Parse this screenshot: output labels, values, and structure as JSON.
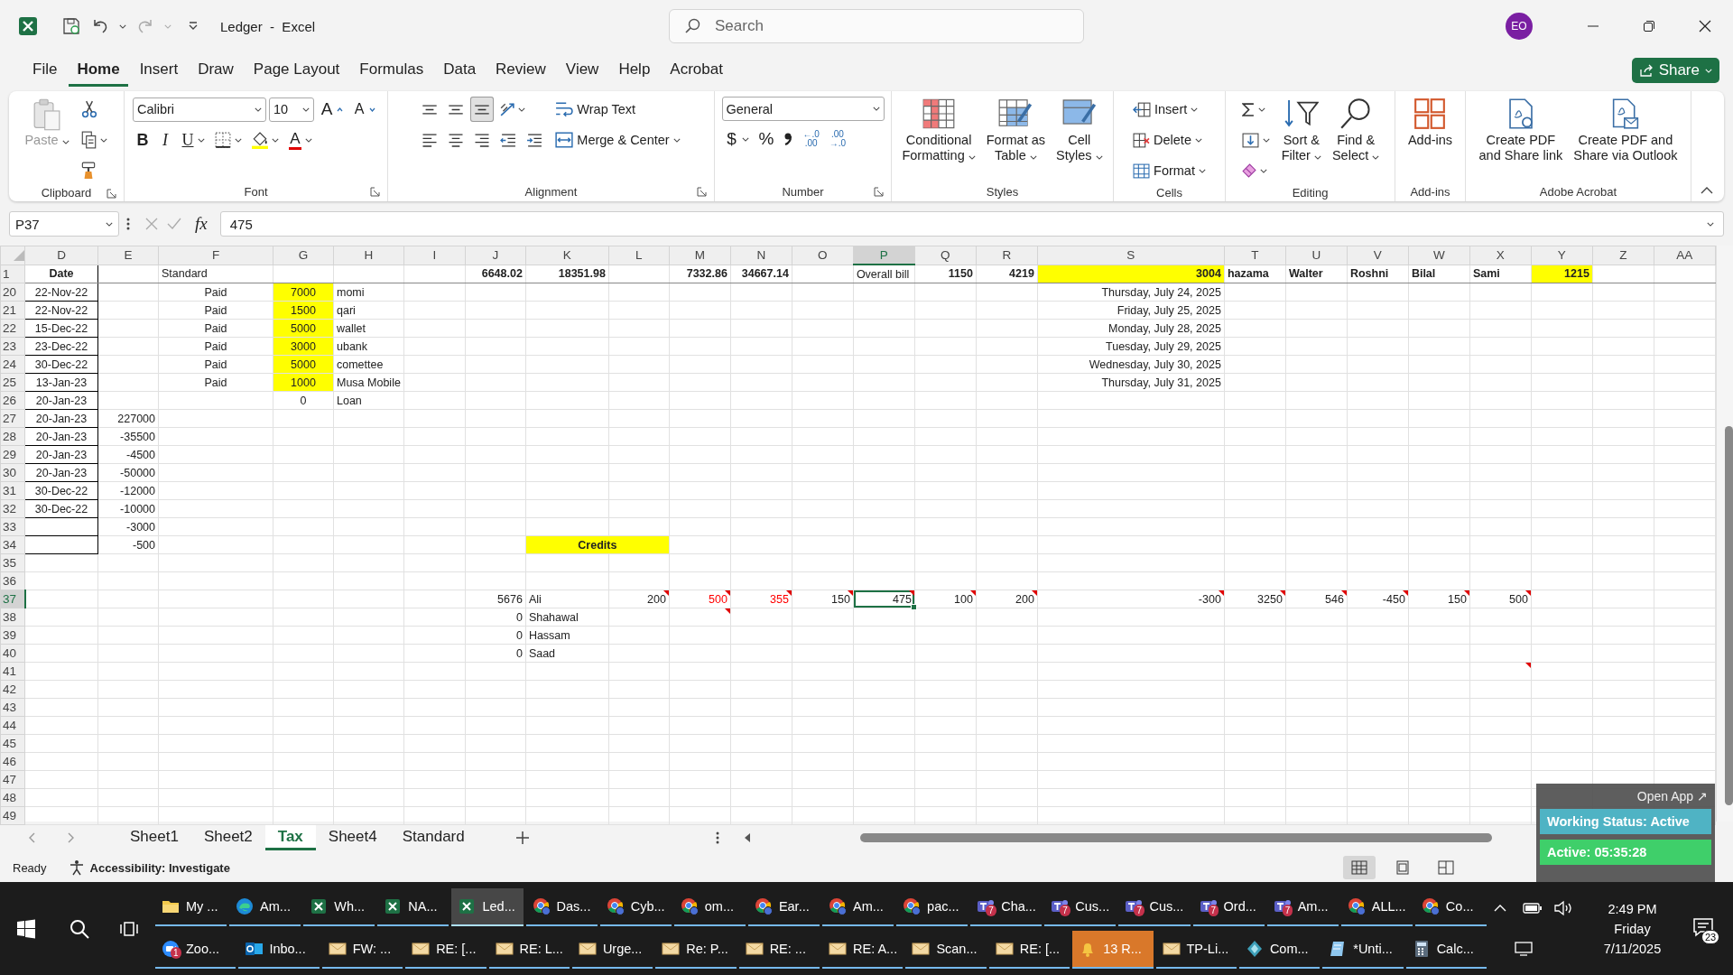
{
  "title_bar": {
    "title": "Ledger  -  Excel",
    "search": {
      "placeholder": "Search"
    },
    "account": {
      "initials": "EO"
    }
  },
  "menu": {
    "tabs": [
      {
        "label": "File",
        "selected": false
      },
      {
        "label": "Home",
        "selected": true
      },
      {
        "label": "Insert",
        "selected": false
      },
      {
        "label": "Draw",
        "selected": false
      },
      {
        "label": "Page Layout",
        "selected": false
      },
      {
        "label": "Formulas",
        "selected": false
      },
      {
        "label": "Data",
        "selected": false
      },
      {
        "label": "Review",
        "selected": false
      },
      {
        "label": "View",
        "selected": false
      },
      {
        "label": "Help",
        "selected": false
      },
      {
        "label": "Acrobat",
        "selected": false
      }
    ],
    "share": "Share"
  },
  "ribbon": {
    "groups": [
      {
        "label": "Clipboard",
        "launcher": true,
        "sections": [
          {
            "kind": "paste",
            "lines": [
              "Paste"
            ],
            "dropdown": true,
            "disabled": true
          },
          {
            "kind": "rows",
            "rows": [
              {
                "tools": [
                  {
                    "kind": "cut"
                  }
                ]
              },
              {
                "tools": [
                  {
                    "kind": "copy",
                    "dropdown": true
                  }
                ]
              },
              {
                "tools": [
                  {
                    "kind": "format-painter"
                  }
                ]
              }
            ]
          }
        ]
      },
      {
        "label": "Font",
        "launcher": true,
        "sections": [
          {
            "kind": "rows",
            "rows": [
              {
                "tools": [
                  {
                    "kind": "font-name",
                    "value": "Calibri"
                  },
                  {
                    "kind": "font-size",
                    "value": "10"
                  },
                  {
                    "kind": "grow-font",
                    "text": "A"
                  },
                  {
                    "kind": "shrink-font",
                    "text": "A"
                  }
                ]
              },
              {
                "tools": [
                  {
                    "kind": "bold",
                    "text": "B"
                  },
                  {
                    "kind": "italic",
                    "text": "I"
                  },
                  {
                    "kind": "underline",
                    "text": "U",
                    "dropdown": true
                  },
                  {
                    "kind": "borders",
                    "dropdown": true
                  },
                  {
                    "kind": "fill-color",
                    "dropdown": true
                  },
                  {
                    "kind": "font-color",
                    "text": "A",
                    "dropdown": true
                  }
                ]
              }
            ]
          }
        ]
      },
      {
        "label": "Alignment",
        "launcher": true,
        "sections": [
          {
            "kind": "rows",
            "rows": [
              {
                "tools": [
                  {
                    "kind": "align-top",
                    "selected": false
                  },
                  {
                    "kind": "align-middle",
                    "selected": false
                  },
                  {
                    "kind": "align-bottom",
                    "selected": true
                  },
                  {
                    "kind": "orientation",
                    "dropdown": true,
                    "selected": false
                  }
                ]
              },
              {
                "tools": [
                  {
                    "kind": "align-left",
                    "selected": false
                  },
                  {
                    "kind": "align-center",
                    "selected": false
                  },
                  {
                    "kind": "align-right",
                    "selected": false
                  },
                  {
                    "kind": "outdent",
                    "selected": false
                  },
                  {
                    "kind": "indent",
                    "selected": false
                  }
                ]
              }
            ]
          },
          {
            "kind": "rows",
            "rows": [
              {
                "tools": [
                  {
                    "kind": "wrap-text",
                    "label": "Wrap Text"
                  }
                ]
              },
              {
                "tools": [
                  {
                    "kind": "merge",
                    "label": "Merge & Center",
                    "dropdown": true
                  }
                ]
              }
            ]
          }
        ]
      },
      {
        "label": "Number",
        "launcher": true,
        "sections": [
          {
            "kind": "rows",
            "rows": [
              {
                "tools": [
                  {
                    "kind": "number-format",
                    "value": "General"
                  }
                ]
              },
              {
                "tools": [
                  {
                    "kind": "currency",
                    "text": "$",
                    "dropdown": true
                  },
                  {
                    "kind": "percent",
                    "text": "%"
                  },
                  {
                    "kind": "comma"
                  },
                  {
                    "kind": "add-decimal",
                    "lines": [
                      "←.0",
                      ".00"
                    ]
                  },
                  {
                    "kind": "remove-decimal",
                    "lines": [
                      ".00",
                      "→.0"
                    ]
                  }
                ]
              }
            ]
          }
        ]
      },
      {
        "label": "Styles",
        "sections": [
          {
            "kind": "conditional-formatting",
            "lines": [
              "Conditional",
              "Formatting"
            ],
            "dropdown": true
          },
          {
            "kind": "format-as-table",
            "lines": [
              "Format as",
              "Table"
            ],
            "dropdown": true
          },
          {
            "kind": "cell-styles",
            "lines": [
              "Cell",
              "Styles"
            ],
            "dropdown": true
          }
        ]
      },
      {
        "label": "Cells",
        "sections": [
          {
            "kind": "rows",
            "rows": [
              {
                "tools": [
                  {
                    "kind": "insert-cells",
                    "label": "Insert",
                    "dropdown": true
                  }
                ]
              },
              {
                "tools": [
                  {
                    "kind": "delete-cells",
                    "label": "Delete",
                    "dropdown": true
                  }
                ]
              },
              {
                "tools": [
                  {
                    "kind": "format-cells",
                    "label": "Format",
                    "dropdown": true
                  }
                ]
              }
            ]
          }
        ]
      },
      {
        "label": "Editing",
        "sections": [
          {
            "kind": "rows",
            "rows": [
              {
                "tools": [
                  {
                    "kind": "autosum",
                    "dropdown": true
                  }
                ]
              },
              {
                "tools": [
                  {
                    "kind": "fill-down",
                    "dropdown": true
                  }
                ]
              },
              {
                "tools": [
                  {
                    "kind": "clear",
                    "dropdown": true
                  }
                ]
              }
            ]
          },
          {
            "kind": "sort-filter",
            "lines": [
              "Sort &",
              "Filter"
            ],
            "dropdown": true
          },
          {
            "kind": "find-select",
            "lines": [
              "Find &",
              "Select"
            ],
            "dropdown": true
          }
        ]
      },
      {
        "label": "Add-ins",
        "sections": [
          {
            "kind": "add-ins",
            "lines": [
              "Add-ins"
            ]
          }
        ]
      },
      {
        "label": "Adobe Acrobat",
        "sections": [
          {
            "kind": "pdf-link",
            "lines": [
              "Create PDF",
              "and Share link"
            ]
          },
          {
            "kind": "pdf-mail",
            "lines": [
              "Create PDF and",
              "Share via Outlook"
            ]
          }
        ]
      }
    ]
  },
  "formula_bar": {
    "name_box": "P37",
    "fx": "fx",
    "value": "475"
  },
  "sheet": {
    "columns": [
      {
        "label": "D",
        "selected": false
      },
      {
        "label": "E",
        "selected": false
      },
      {
        "label": "F",
        "selected": false
      },
      {
        "label": "G",
        "selected": false
      },
      {
        "label": "H",
        "selected": false
      },
      {
        "label": "I",
        "selected": false
      },
      {
        "label": "J",
        "selected": false
      },
      {
        "label": "K",
        "selected": false
      },
      {
        "label": "L",
        "selected": false
      },
      {
        "label": "M",
        "selected": false
      },
      {
        "label": "N",
        "selected": false
      },
      {
        "label": "O",
        "selected": false
      },
      {
        "label": "P",
        "selected": true
      },
      {
        "label": "Q",
        "selected": false
      },
      {
        "label": "R",
        "selected": false
      },
      {
        "label": "S",
        "selected": false
      },
      {
        "label": "T",
        "selected": false
      },
      {
        "label": "U",
        "selected": false
      },
      {
        "label": "V",
        "selected": false
      },
      {
        "label": "W",
        "selected": false
      },
      {
        "label": "X",
        "selected": false
      },
      {
        "label": "Y",
        "selected": false
      },
      {
        "label": "Z",
        "selected": false
      },
      {
        "label": "AA",
        "selected": false
      }
    ],
    "rows": [
      {
        "number": "1",
        "selected": false,
        "cells": {
          "D": {
            "text": "Date",
            "kind": "center",
            "bold": true,
            "boxed": true,
            "selected": false
          },
          "F": {
            "text": "Standard",
            "kind": "text",
            "selected": false
          },
          "J": {
            "text": "6648.02",
            "kind": "number",
            "bold": true,
            "selected": false
          },
          "K": {
            "text": "18351.98",
            "kind": "number",
            "bold": true,
            "selected": false
          },
          "M": {
            "text": "7332.86",
            "kind": "number",
            "bold": true,
            "selected": false
          },
          "N": {
            "text": "34667.14",
            "kind": "number",
            "bold": true,
            "selected": false
          },
          "P": {
            "text": "Overall bill",
            "kind": "text",
            "selected": false
          },
          "Q": {
            "text": "1150",
            "kind": "number",
            "bold": true,
            "selected": false
          },
          "R": {
            "text": "4219",
            "kind": "number",
            "bold": true,
            "selected": false
          },
          "S": {
            "text": "3004",
            "kind": "number",
            "bold": true,
            "highlighted": true,
            "selected": false
          },
          "T": {
            "text": "hazama",
            "kind": "text",
            "bold": true,
            "selected": false
          },
          "U": {
            "text": "Walter",
            "kind": "text",
            "bold": true,
            "selected": false
          },
          "V": {
            "text": "Roshni",
            "kind": "text",
            "bold": true,
            "selected": false
          },
          "W": {
            "text": "Bilal",
            "kind": "text",
            "bold": true,
            "selected": false
          },
          "X": {
            "text": "Sami",
            "kind": "text",
            "bold": true,
            "selected": false
          },
          "Y": {
            "text": "1215",
            "kind": "number",
            "bold": true,
            "highlighted": true,
            "selected": false
          }
        }
      },
      {
        "number": "20",
        "selected": false,
        "cells": {
          "D": {
            "text": "22-Nov-22",
            "kind": "center",
            "boxed": true,
            "selected": false
          },
          "F": {
            "text": "Paid",
            "kind": "center",
            "selected": false
          },
          "G": {
            "text": "7000",
            "kind": "center",
            "highlighted": true,
            "selected": false
          },
          "H": {
            "text": "momi",
            "selected": false
          },
          "S": {
            "text": "Thursday, July 24, 2025",
            "kind": "number",
            "selected": false
          }
        }
      },
      {
        "number": "21",
        "selected": false,
        "cells": {
          "D": {
            "text": "22-Nov-22",
            "kind": "center",
            "boxed": true,
            "selected": false
          },
          "F": {
            "text": "Paid",
            "kind": "center",
            "selected": false
          },
          "G": {
            "text": "1500",
            "kind": "center",
            "highlighted": true,
            "selected": false
          },
          "H": {
            "text": "qari",
            "selected": false
          },
          "S": {
            "text": "Friday, July 25, 2025",
            "kind": "number",
            "selected": false
          }
        }
      },
      {
        "number": "22",
        "selected": false,
        "cells": {
          "D": {
            "text": "15-Dec-22",
            "kind": "center",
            "boxed": true,
            "selected": false
          },
          "F": {
            "text": "Paid",
            "kind": "center",
            "selected": false
          },
          "G": {
            "text": "5000",
            "kind": "center",
            "highlighted": true,
            "selected": false
          },
          "H": {
            "text": "wallet",
            "selected": false
          },
          "S": {
            "text": "Monday, July 28, 2025",
            "kind": "number",
            "selected": false
          }
        }
      },
      {
        "number": "23",
        "selected": false,
        "cells": {
          "D": {
            "text": "23-Dec-22",
            "kind": "center",
            "boxed": true,
            "selected": false
          },
          "F": {
            "text": "Paid",
            "kind": "center",
            "selected": false
          },
          "G": {
            "text": "3000",
            "kind": "center",
            "highlighted": true,
            "selected": false
          },
          "H": {
            "text": "ubank",
            "selected": false
          },
          "S": {
            "text": "Tuesday, July 29, 2025",
            "kind": "number",
            "selected": false
          }
        }
      },
      {
        "number": "24",
        "selected": false,
        "cells": {
          "D": {
            "text": "30-Dec-22",
            "kind": "center",
            "boxed": true,
            "selected": false
          },
          "F": {
            "text": "Paid",
            "kind": "center",
            "selected": false
          },
          "G": {
            "text": "5000",
            "kind": "center",
            "highlighted": true,
            "selected": false
          },
          "H": {
            "text": "comettee",
            "selected": false
          },
          "S": {
            "text": "Wednesday, July 30, 2025",
            "kind": "number",
            "selected": false
          }
        }
      },
      {
        "number": "25",
        "selected": false,
        "cells": {
          "D": {
            "text": "13-Jan-23",
            "kind": "center",
            "boxed": true,
            "selected": false
          },
          "F": {
            "text": "Paid",
            "kind": "center",
            "selected": false
          },
          "G": {
            "text": "1000",
            "kind": "center",
            "highlighted": true,
            "selected": false
          },
          "H": {
            "text": "Musa Mobile",
            "selected": false
          },
          "S": {
            "text": "Thursday, July 31, 2025",
            "kind": "number",
            "selected": false
          }
        }
      },
      {
        "number": "26",
        "selected": false,
        "cells": {
          "D": {
            "text": "20-Jan-23",
            "kind": "center",
            "boxed": true,
            "selected": false
          },
          "G": {
            "text": "0",
            "kind": "center",
            "selected": false
          },
          "H": {
            "text": "Loan",
            "selected": false
          }
        }
      },
      {
        "number": "27",
        "selected": false,
        "cells": {
          "D": {
            "text": "20-Jan-23",
            "kind": "center",
            "boxed": true,
            "selected": false
          },
          "E": {
            "text": "227000",
            "kind": "number",
            "selected": false
          }
        }
      },
      {
        "number": "28",
        "selected": false,
        "cells": {
          "D": {
            "text": "20-Jan-23",
            "kind": "center",
            "boxed": true,
            "selected": false
          },
          "E": {
            "text": "-35500",
            "kind": "number",
            "selected": false
          }
        }
      },
      {
        "number": "29",
        "selected": false,
        "cells": {
          "D": {
            "text": "20-Jan-23",
            "kind": "center",
            "boxed": true,
            "selected": false
          },
          "E": {
            "text": "-4500",
            "kind": "number",
            "selected": false
          }
        }
      },
      {
        "number": "30",
        "selected": false,
        "cells": {
          "D": {
            "text": "20-Jan-23",
            "kind": "center",
            "boxed": true,
            "selected": false
          },
          "E": {
            "text": "-50000",
            "kind": "number",
            "selected": false
          }
        }
      },
      {
        "number": "31",
        "selected": false,
        "cells": {
          "D": {
            "text": "30-Dec-22",
            "kind": "center",
            "boxed": true,
            "selected": false
          },
          "E": {
            "text": "-12000",
            "kind": "number",
            "selected": false
          }
        }
      },
      {
        "number": "32",
        "selected": false,
        "cells": {
          "D": {
            "text": "30-Dec-22",
            "kind": "center",
            "boxed": true,
            "selected": false
          },
          "E": {
            "text": "-10000",
            "kind": "number",
            "selected": false
          }
        }
      },
      {
        "number": "33",
        "selected": false,
        "cells": {
          "D": {
            "boxed": true,
            "selected": false
          },
          "E": {
            "text": "-3000",
            "kind": "number",
            "selected": false
          }
        }
      },
      {
        "number": "34",
        "selected": false,
        "cells": {
          "D": {
            "boxed": true,
            "selected": false
          },
          "E": {
            "text": "-500",
            "kind": "number",
            "selected": false
          },
          "K": {
            "text": "Credits",
            "kind": "center",
            "bold": true,
            "highlighted": true,
            "merged": true,
            "selected": false
          }
        }
      },
      {
        "number": "35",
        "selected": false
      },
      {
        "number": "36",
        "selected": false
      },
      {
        "number": "37",
        "selected": true,
        "cells": {
          "J": {
            "text": "5676",
            "kind": "number",
            "selected": false
          },
          "K": {
            "text": "Ali",
            "kind": "text",
            "selected": false
          },
          "L": {
            "text": "200",
            "kind": "number",
            "comment": true,
            "selected": false
          },
          "M": {
            "text": "500",
            "kind": "number",
            "comment": true,
            "color": "#ff0000",
            "selected": false
          },
          "N": {
            "text": "355",
            "kind": "number",
            "comment": true,
            "color": "#ff0000",
            "selected": false
          },
          "O": {
            "text": "150",
            "kind": "number",
            "comment": true,
            "selected": false
          },
          "P": {
            "text": "475",
            "kind": "number",
            "comment": true,
            "selected": true
          },
          "Q": {
            "text": "100",
            "kind": "number",
            "comment": true,
            "selected": false
          },
          "R": {
            "text": "200",
            "kind": "number",
            "comment": true,
            "selected": false
          },
          "S": {
            "text": "-300",
            "kind": "number",
            "comment": true,
            "selected": false
          },
          "T": {
            "text": "3250",
            "kind": "number",
            "comment": true,
            "selected": false
          },
          "U": {
            "text": "546",
            "kind": "number",
            "comment": true,
            "selected": false
          },
          "V": {
            "text": "-450",
            "kind": "number",
            "comment": true,
            "selected": false
          },
          "W": {
            "text": "150",
            "kind": "number",
            "comment": true,
            "selected": false
          },
          "X": {
            "text": "500",
            "kind": "number",
            "comment": true,
            "selected": false
          }
        }
      },
      {
        "number": "38",
        "selected": false,
        "cells": {
          "J": {
            "text": "0",
            "kind": "number",
            "selected": false
          },
          "K": {
            "text": "Shahawal",
            "kind": "text",
            "selected": false
          },
          "M": {
            "comment": true,
            "selected": false
          }
        }
      },
      {
        "number": "39",
        "selected": false,
        "cells": {
          "J": {
            "text": "0",
            "kind": "number",
            "selected": false
          },
          "K": {
            "text": "Hassam",
            "kind": "text",
            "selected": false
          }
        }
      },
      {
        "number": "40",
        "selected": false,
        "cells": {
          "J": {
            "text": "0",
            "kind": "number",
            "selected": false
          },
          "K": {
            "text": "Saad",
            "kind": "text",
            "selected": false
          }
        }
      },
      {
        "number": "41",
        "selected": false,
        "cells": {
          "X": {
            "comment": true,
            "selected": false
          }
        }
      },
      {
        "number": "42",
        "selected": false
      },
      {
        "number": "43",
        "selected": false
      },
      {
        "number": "44",
        "selected": false
      },
      {
        "number": "45",
        "selected": false
      },
      {
        "number": "46",
        "selected": false
      },
      {
        "number": "47",
        "selected": false
      },
      {
        "number": "48",
        "selected": false
      },
      {
        "number": "49",
        "selected": false
      }
    ]
  },
  "sheet_tabs": [
    {
      "label": "Sheet1",
      "selected": false
    },
    {
      "label": "Sheet2",
      "selected": false
    },
    {
      "label": "Tax",
      "selected": true
    },
    {
      "label": "Sheet4",
      "selected": false
    },
    {
      "label": "Standard",
      "selected": false
    }
  ],
  "status_bar": {
    "mode": "Ready",
    "accessibility": "Accessibility: Investigate",
    "views": [
      {
        "kind": "normal",
        "selected": true
      },
      {
        "kind": "page-layout",
        "selected": false
      },
      {
        "kind": "page-break",
        "selected": false
      }
    ]
  },
  "overlay": {
    "open_app": "Open App ↗",
    "status": "Working Status: Active",
    "timer": "Active: 05:35:28"
  },
  "taskbar": {
    "rows": [
      {
        "items": [
          {
            "label": "My ...",
            "kind": "folder",
            "selected": false
          },
          {
            "label": "Am...",
            "kind": "edge",
            "selected": false
          },
          {
            "label": "Wh...",
            "kind": "excel",
            "selected": false
          },
          {
            "label": "NA...",
            "kind": "excel",
            "selected": false
          },
          {
            "label": "Led...",
            "kind": "excel",
            "selected": true
          },
          {
            "label": "Das...",
            "kind": "chrome",
            "selected": false
          },
          {
            "label": "Cyb...",
            "kind": "chrome",
            "selected": false
          },
          {
            "label": "om...",
            "kind": "chrome",
            "selected": false
          },
          {
            "label": "Ear...",
            "kind": "chrome",
            "selected": false
          },
          {
            "label": "Am...",
            "kind": "chrome",
            "selected": false
          },
          {
            "label": "pac...",
            "kind": "chrome",
            "selected": false
          },
          {
            "label": "Cha...",
            "kind": "teams",
            "badge": "7",
            "selected": false
          },
          {
            "label": "Cus...",
            "kind": "teams",
            "badge": "7",
            "selected": false
          },
          {
            "label": "Cus...",
            "kind": "teams",
            "badge": "7",
            "selected": false
          },
          {
            "label": "Ord...",
            "kind": "teams",
            "badge": "7",
            "selected": false
          },
          {
            "label": "Am...",
            "kind": "teams",
            "badge": "7",
            "selected": false
          },
          {
            "label": "ALL...",
            "kind": "chrome",
            "selected": false
          },
          {
            "label": "Co...",
            "kind": "chrome",
            "selected": false
          }
        ]
      },
      {
        "items": [
          {
            "label": "Zoo...",
            "kind": "zoom",
            "badge": "1",
            "selected": false
          },
          {
            "label": "Inbo...",
            "kind": "outlook",
            "selected": false
          },
          {
            "label": "FW: ...",
            "kind": "mail",
            "selected": false
          },
          {
            "label": "RE: [...",
            "kind": "mail",
            "selected": false
          },
          {
            "label": "RE: L...",
            "kind": "mail",
            "selected": false
          },
          {
            "label": "Urge...",
            "kind": "mail",
            "selected": false
          },
          {
            "label": "Re: P...",
            "kind": "mail",
            "selected": false
          },
          {
            "label": "RE: ...",
            "kind": "mail",
            "selected": false
          },
          {
            "label": "RE: A...",
            "kind": "mail",
            "selected": false
          },
          {
            "label": "Scan...",
            "kind": "mail",
            "selected": false
          },
          {
            "label": "RE: [...",
            "kind": "mail",
            "selected": false
          },
          {
            "label": "13 R...",
            "kind": "bell",
            "attention": true,
            "selected": false
          },
          {
            "label": "TP-Li...",
            "kind": "mail",
            "selected": false
          },
          {
            "label": "Com...",
            "kind": "app",
            "selected": false
          },
          {
            "label": "*Unti...",
            "kind": "notepad",
            "selected": false
          },
          {
            "label": "Calc...",
            "kind": "calc",
            "selected": false
          }
        ]
      }
    ],
    "tray": {
      "time": "2:49 PM",
      "day": "Friday",
      "date": "7/11/2025",
      "notifications": "23"
    }
  }
}
